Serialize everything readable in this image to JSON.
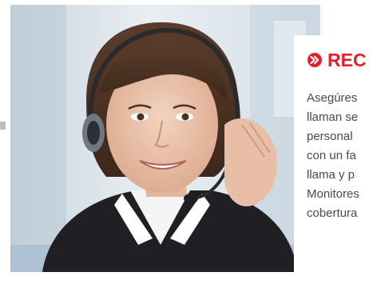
{
  "heading": {
    "icon": "double-chevron-right-icon",
    "text": "REC",
    "color": "#e2202b"
  },
  "body": {
    "lines": [
      "Asegúres",
      "llaman se",
      "personal",
      "con un fa",
      "llama y p",
      "Monitores",
      "cobertura"
    ]
  },
  "photo": {
    "subject": "customer-service-agent-with-headset"
  }
}
